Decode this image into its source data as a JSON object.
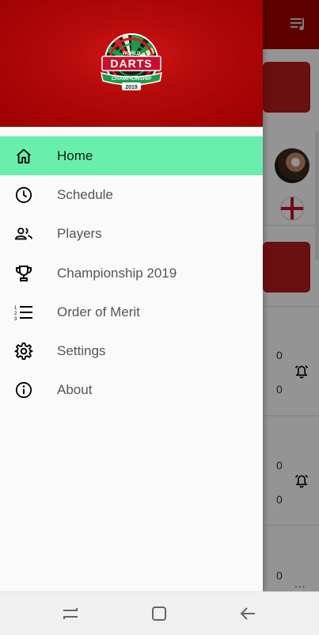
{
  "app": {
    "logo_text_top": "WORLD",
    "logo_text_main": "DARTS",
    "logo_text_banner": "CHAMPIONSHIP",
    "logo_text_year": "2019",
    "brand_color": "#a10000",
    "accent_color": "#69efac"
  },
  "drawer": {
    "items": [
      {
        "label": "Home",
        "icon": "home-icon",
        "active": true
      },
      {
        "label": "Schedule",
        "icon": "clock-icon",
        "active": false
      },
      {
        "label": "Players",
        "icon": "people-icon",
        "active": false
      },
      {
        "label": "Championship 2019",
        "icon": "trophy-icon",
        "active": false
      },
      {
        "label": "Order of Merit",
        "icon": "ordered-list-icon",
        "active": false
      },
      {
        "label": "Settings",
        "icon": "gear-icon",
        "active": false
      },
      {
        "label": "About",
        "icon": "info-icon",
        "active": false
      }
    ]
  },
  "background": {
    "scores": [
      "0",
      "0",
      "0",
      "0",
      "0"
    ],
    "more_label": "..."
  },
  "navbar": {
    "buttons": [
      "recent-apps-icon",
      "home-button-icon",
      "back-icon"
    ]
  }
}
